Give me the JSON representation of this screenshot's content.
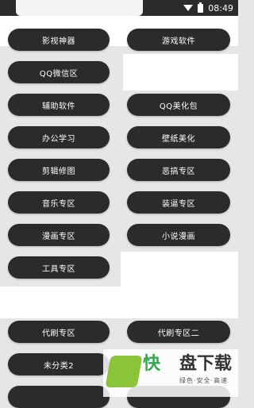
{
  "status_bar": {
    "time": "08:49"
  },
  "menu": {
    "film": "影视神器",
    "game": "游戏软件",
    "qq_wechat": "QQ微信区",
    "assist": "辅助软件",
    "qq_beauty": "QQ美化包",
    "office": "办公学习",
    "wallpaper": "壁纸美化",
    "edit": "剪辑修图",
    "prank": "恶搞专区",
    "music": "音乐专区",
    "showoff": "装逼专区",
    "comic": "漫画专区",
    "novel": "小说漫画",
    "tools": "工具专区",
    "proxy": "代刷专区",
    "proxy2": "代刷专区二",
    "uncat2": "未分类2"
  },
  "watermark": {
    "brand_icon": "快",
    "brand_text": "盘下载",
    "slogan": "绿色·安全·高速"
  }
}
